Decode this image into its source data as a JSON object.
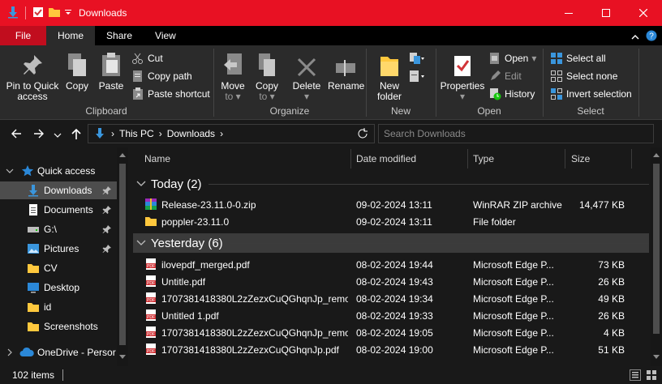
{
  "window": {
    "title": "Downloads"
  },
  "colors": {
    "titlebar": "#e81123",
    "accent": "#2b88d8"
  },
  "tabs": [
    {
      "label": "File"
    },
    {
      "label": "Home"
    },
    {
      "label": "Share"
    },
    {
      "label": "View"
    }
  ],
  "ribbon": {
    "clipboard": {
      "label": "Clipboard",
      "pin": "Pin to Quick",
      "pin2": "access",
      "copy": "Copy",
      "paste": "Paste",
      "cut": "Cut",
      "copy_path": "Copy path",
      "paste_shortcut": "Paste shortcut"
    },
    "organize": {
      "label": "Organize",
      "move": "Move",
      "move_to": "to",
      "copy": "Copy",
      "copy_to": "to",
      "delete": "Delete",
      "rename": "Rename"
    },
    "new": {
      "label": "New",
      "new_folder": "New",
      "new_folder2": "folder"
    },
    "open": {
      "label": "Open",
      "properties": "Properties",
      "open": "Open",
      "edit": "Edit",
      "history": "History"
    },
    "select": {
      "label": "Select",
      "all": "Select all",
      "none": "Select none",
      "invert": "Invert selection"
    }
  },
  "address": {
    "crumbs": [
      "This PC",
      "Downloads"
    ],
    "search_placeholder": "Search Downloads"
  },
  "navpane": {
    "quick_access": "Quick access",
    "items": [
      {
        "label": "Downloads",
        "icon": "download-arrow-icon",
        "pinned": true
      },
      {
        "label": "Documents",
        "icon": "document-icon",
        "pinned": true
      },
      {
        "label": "G:\\",
        "icon": "drive-icon",
        "pinned": true
      },
      {
        "label": "Pictures",
        "icon": "pictures-icon",
        "pinned": true
      },
      {
        "label": "CV",
        "icon": "folder-icon",
        "pinned": false
      },
      {
        "label": "Desktop",
        "icon": "desktop-icon",
        "pinned": false
      },
      {
        "label": "id",
        "icon": "folder-icon",
        "pinned": false
      },
      {
        "label": "Screenshots",
        "icon": "folder-icon",
        "pinned": false
      }
    ],
    "onedrive": "OneDrive - Persor"
  },
  "columns": {
    "name": "Name",
    "date": "Date modified",
    "type": "Type",
    "size": "Size"
  },
  "groups": [
    {
      "label": "Today (2)",
      "files": [
        {
          "name": "Release-23.11.0-0.zip",
          "date": "09-02-2024 13:11",
          "type": "WinRAR ZIP archive",
          "size": "14,477 KB",
          "icon": "winrar-icon"
        },
        {
          "name": "poppler-23.11.0",
          "date": "09-02-2024 13:11",
          "type": "File folder",
          "size": "",
          "icon": "folder-icon"
        }
      ]
    },
    {
      "label": "Yesterday (6)",
      "files": [
        {
          "name": "ilovepdf_merged.pdf",
          "date": "08-02-2024 19:44",
          "type": "Microsoft Edge P...",
          "size": "73 KB",
          "icon": "pdf-icon"
        },
        {
          "name": "Untitle.pdf",
          "date": "08-02-2024 19:43",
          "type": "Microsoft Edge P...",
          "size": "26 KB",
          "icon": "pdf-icon"
        },
        {
          "name": "1707381418380L2zZezxCuQGhqnJp_remo...",
          "date": "08-02-2024 19:34",
          "type": "Microsoft Edge P...",
          "size": "49 KB",
          "icon": "pdf-icon"
        },
        {
          "name": "Untitled 1.pdf",
          "date": "08-02-2024 19:33",
          "type": "Microsoft Edge P...",
          "size": "26 KB",
          "icon": "pdf-icon"
        },
        {
          "name": "1707381418380L2zZezxCuQGhqnJp_remo...",
          "date": "08-02-2024 19:05",
          "type": "Microsoft Edge P...",
          "size": "4 KB",
          "icon": "pdf-icon"
        },
        {
          "name": "1707381418380L2zZezxCuQGhqnJp.pdf",
          "date": "08-02-2024 19:00",
          "type": "Microsoft Edge P...",
          "size": "51 KB",
          "icon": "pdf-icon"
        }
      ]
    }
  ],
  "status": {
    "count": "102 items"
  }
}
